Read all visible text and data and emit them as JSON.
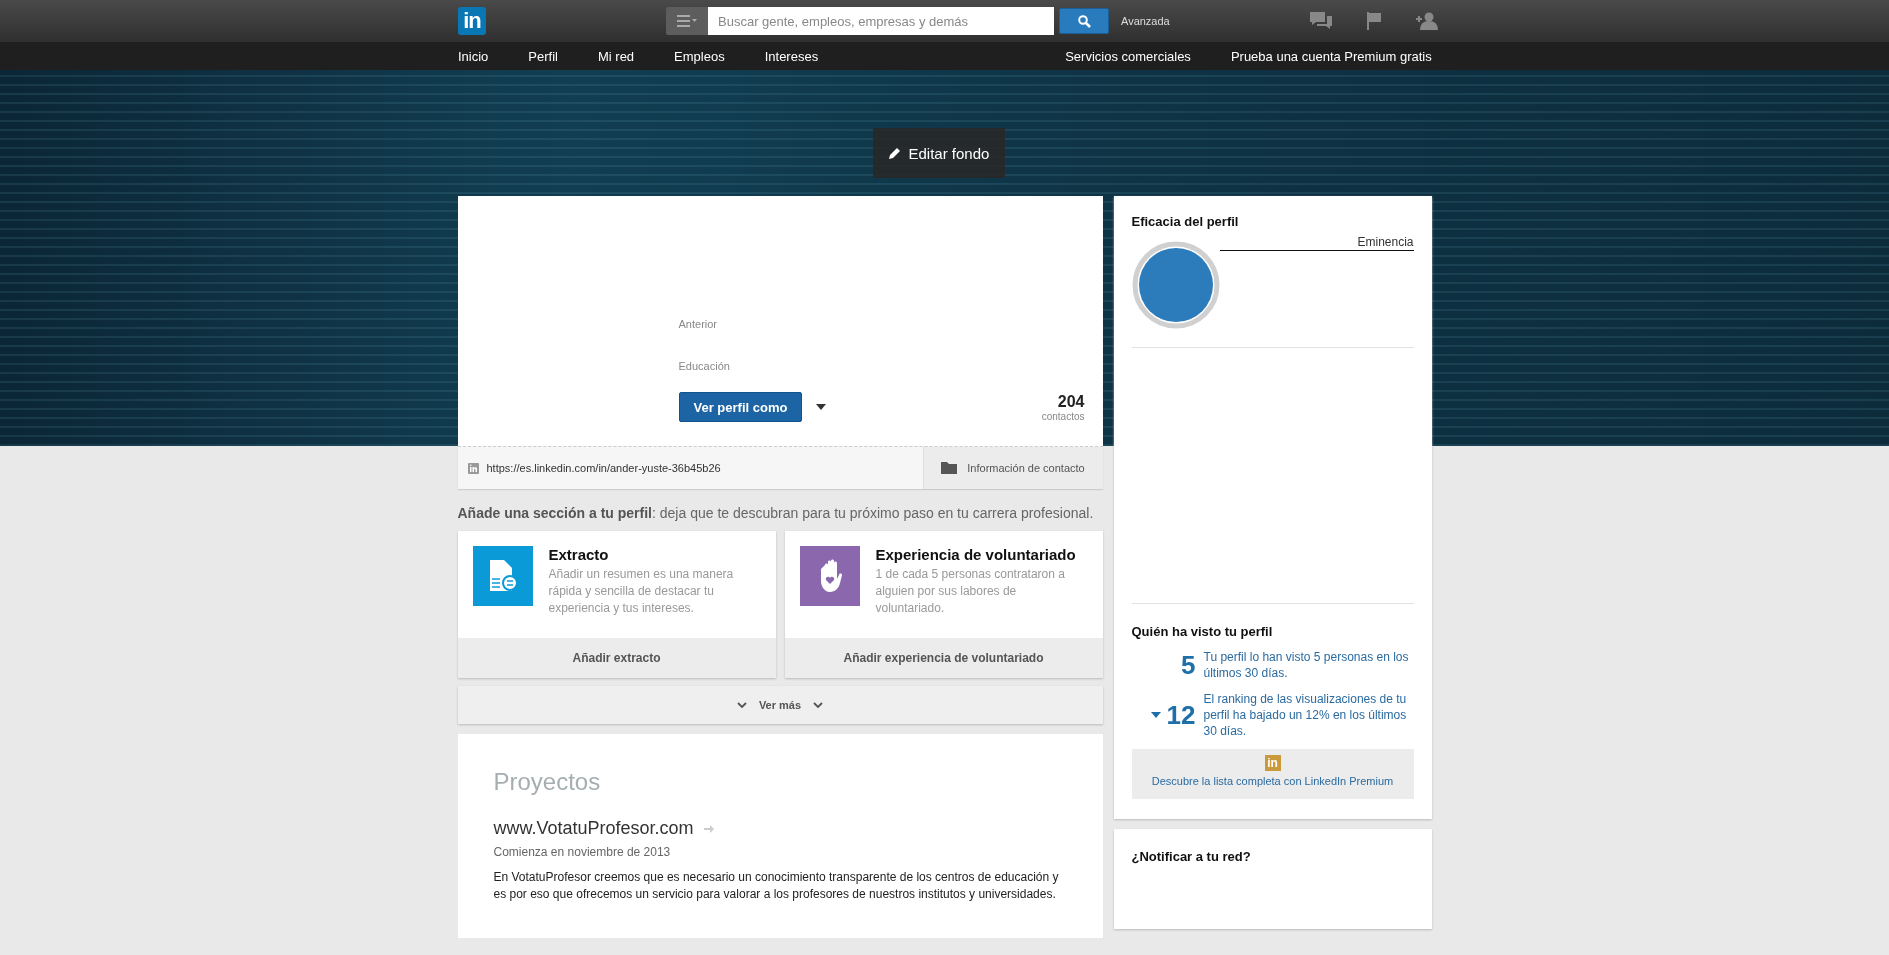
{
  "header": {
    "logo": "in",
    "search": {
      "placeholder": "Buscar gente, empleos, empresas y demás"
    },
    "advanced": "Avanzada"
  },
  "nav": {
    "left": [
      "Inicio",
      "Perfil",
      "Mi red",
      "Empleos",
      "Intereses"
    ],
    "right": [
      "Servicios comerciales",
      "Prueba una cuenta Premium gratis"
    ]
  },
  "banner": {
    "edit_button": "Editar fondo"
  },
  "profile": {
    "labels": [
      "Anterior",
      "Educación"
    ],
    "view_as_button": "Ver perfil como",
    "contacts_count": "204",
    "contacts_label": "contactos",
    "url": "https://es.linkedin.com/in/ander-yuste-36b45b26",
    "contact_info": "Información de contacto"
  },
  "add_section": {
    "prompt": "**Añade una sección a tu perfil**: deja que te descubran para tu próximo paso en tu carrera profesional.",
    "cards": [
      {
        "kind": "summary",
        "title": "Extracto",
        "description": "Añadir un resumen es una manera rápida y sencilla de destacar tu experiencia y tus intereses.",
        "action": "Añadir extracto"
      },
      {
        "kind": "volunteer",
        "title": "Experiencia de voluntariado",
        "description": "1 de cada 5 personas contrataron a alguien por sus labores de voluntariado.",
        "action": "Añadir experiencia de voluntariado"
      }
    ],
    "more": "Ver más"
  },
  "projects": {
    "heading": "Proyectos",
    "title": "www.VotatuProfesor.com",
    "date": "Comienza en noviembre de 2013",
    "description": "En VotatuProfesor creemos que es necesario un conocimiento transparente de los centros de educación y es por eso que ofrecemos un servicio para valorar a los profesores de nuestros institutos y universidades."
  },
  "effectiveness": {
    "title": "Eficacia del perfil",
    "label": "Eminencia"
  },
  "viewers": {
    "title": "Quién ha visto tu perfil",
    "stats": [
      {
        "number": "5",
        "text": "Tu perfil lo han visto 5 personas en los últimos 30 días.",
        "kind": "plain"
      },
      {
        "number": "12",
        "text": "El ranking de las visualizaciones de tu perfil ha bajado un 12% en los últimos 30 días.",
        "kind": "decline"
      }
    ],
    "premium_logo": "in",
    "premium": "Descubre la lista completa con LinkedIn Premium"
  },
  "notify": {
    "title": "¿Notificar a tu red?"
  }
}
